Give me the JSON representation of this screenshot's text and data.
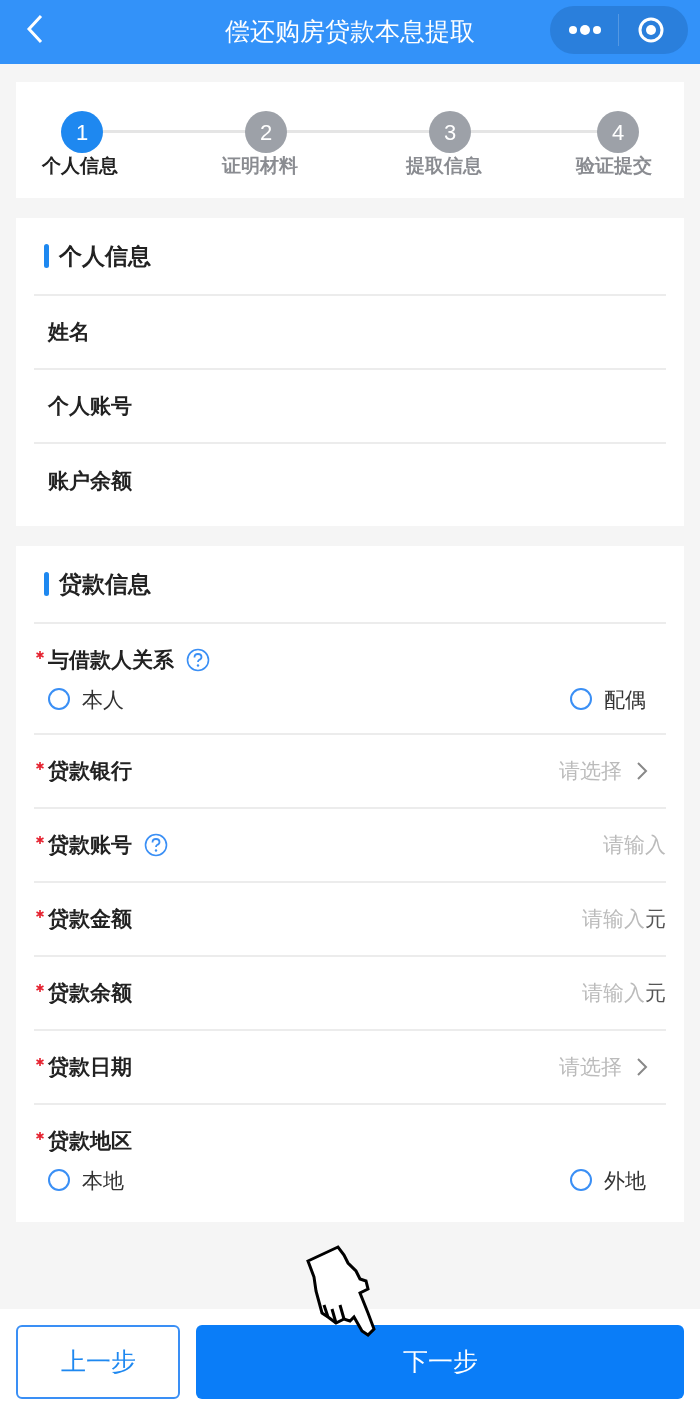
{
  "header": {
    "title": "偿还购房贷款本息提取"
  },
  "steps": [
    {
      "number": "1",
      "label": "个人信息",
      "selected": true
    },
    {
      "number": "2",
      "label": "证明材料",
      "selected": false
    },
    {
      "number": "3",
      "label": "提取信息",
      "selected": false
    },
    {
      "number": "4",
      "label": "验证提交",
      "selected": false
    }
  ],
  "sections": [
    {
      "title": "个人信息",
      "fields": [
        {
          "kind": "display",
          "label": "姓名",
          "required": false
        },
        {
          "kind": "display",
          "label": "个人账号",
          "required": false
        },
        {
          "kind": "display",
          "label": "账户余额",
          "required": false
        }
      ]
    },
    {
      "title": "贷款信息",
      "fields": [
        {
          "kind": "radio",
          "label": "与借款人关系",
          "required": true,
          "help": true,
          "options": [
            {
              "label": "本人",
              "checked": false
            },
            {
              "label": "配偶",
              "checked": false
            }
          ]
        },
        {
          "kind": "select",
          "label": "贷款银行",
          "required": true,
          "placeholder": "请选择"
        },
        {
          "kind": "input",
          "label": "贷款账号",
          "required": true,
          "help": true,
          "placeholder": "请输入"
        },
        {
          "kind": "input",
          "label": "贷款金额",
          "required": true,
          "placeholder": "请输入",
          "unit": "元"
        },
        {
          "kind": "input",
          "label": "贷款余额",
          "required": true,
          "placeholder": "请输入",
          "unit": "元"
        },
        {
          "kind": "select",
          "label": "贷款日期",
          "required": true,
          "placeholder": "请选择"
        },
        {
          "kind": "radio",
          "label": "贷款地区",
          "required": true,
          "options": [
            {
              "label": "本地",
              "checked": false
            },
            {
              "label": "外地",
              "checked": false
            }
          ]
        }
      ]
    }
  ],
  "buttons": {
    "prev": "上一步",
    "next": "下一步"
  }
}
